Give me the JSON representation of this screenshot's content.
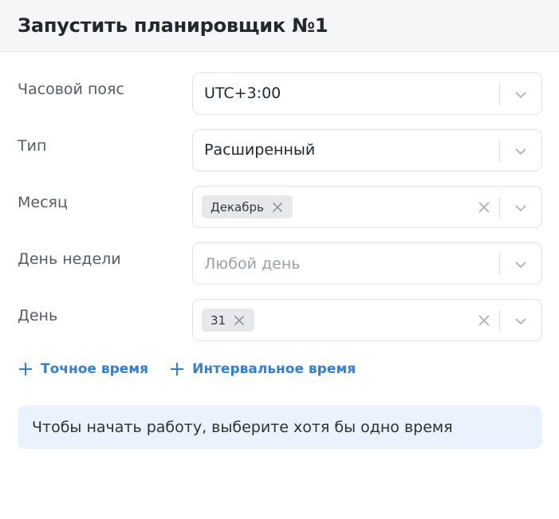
{
  "dialog": {
    "title": "Запустить планировщик №1"
  },
  "fields": {
    "timezone": {
      "label": "Часовой пояс",
      "value": "UTC+3:00"
    },
    "type": {
      "label": "Тип",
      "value": "Расширенный"
    },
    "month": {
      "label": "Месяц",
      "chips": [
        "Декабрь"
      ]
    },
    "weekday": {
      "label": "День недели",
      "placeholder": "Любой день"
    },
    "day": {
      "label": "День",
      "chips": [
        "31"
      ]
    }
  },
  "actions": {
    "exact_time": "Точное время",
    "interval_time": "Интервальное время"
  },
  "info": {
    "message": "Чтобы начать работу, выберите хотя бы одно время"
  },
  "icons": {
    "chevron": "chevron-down-icon",
    "clear": "close-icon",
    "add": "plus-icon"
  },
  "colors": {
    "accent": "#2f80d9",
    "header_bg": "#f5f6f8",
    "info_bg": "#eaf3fd",
    "chip_bg": "#e6e8eb"
  }
}
